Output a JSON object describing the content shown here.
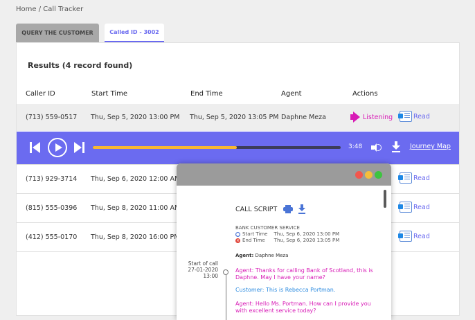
{
  "breadcrumb": "Home / Call Tracker",
  "tabs": {
    "query": "QUERY THE CUSTOMER",
    "called": "Called ID - 3002"
  },
  "results_title": "Results (4 record found)",
  "columns": [
    "Caller ID",
    "Start Time",
    "End Time",
    "Agent",
    "Actions"
  ],
  "rows": [
    {
      "caller": "(713) 559-0517",
      "start": "Thu, Sep 5, 2020 13:00 PM",
      "end": "Thu, Sep 5, 2020 13:05 PM",
      "agent": "Daphne Meza",
      "listen": "Listening",
      "read": "Read"
    },
    {
      "caller": "(713) 929-3714",
      "start": "Thu, Sep 6, 2020 12:00 AM",
      "read": "Read"
    },
    {
      "caller": "(815) 555-0396",
      "start": "Thu, Sep 8, 2020 11:00 AM",
      "read": "Read"
    },
    {
      "caller": "(412) 555-0170",
      "start": "Thu, Sep 8, 2020 16:00 PM",
      "read": "Read"
    }
  ],
  "player": {
    "time": "3:48",
    "progress": 0.58,
    "journey": "Journey Map"
  },
  "popup": {
    "title": "CALL SCRIPT",
    "service": "BANK CUSTOMER SERVICE",
    "start_label": "Start Time",
    "start_value": "Thu, Sep 6, 2020 13:00 PM",
    "end_label": "End Time",
    "end_value": "Thu, Sep 6, 2020 13:05 PM",
    "agent_label": "Agent:",
    "agent_name": "Daphne Meza",
    "start_of_call": "Start of call",
    "date": "27-01-2020",
    "time": "13:00",
    "messages": [
      {
        "who": "agent",
        "text": "Agent: Thanks for calling Bank of Scotland, this is Daphne. May I have your name?"
      },
      {
        "who": "customer",
        "text": "Customer: This is Rebecca Portman."
      },
      {
        "who": "agent",
        "text": "Agent: Hello Ms. Portman. How can I provide you with excellent service today?"
      }
    ]
  },
  "colors": {
    "accent": "#6b6bf0",
    "listening": "#d81bb6",
    "progress": "#f7b733"
  }
}
